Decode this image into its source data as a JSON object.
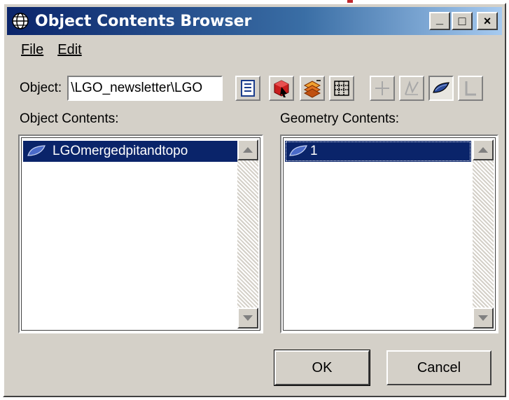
{
  "window": {
    "title": "Object Contents Browser",
    "title_icon": "globe-icon",
    "controls": {
      "minimize": "_",
      "maximize": "□",
      "close": "×"
    }
  },
  "menu": {
    "file": "File",
    "edit": "Edit"
  },
  "object": {
    "label": "Object:",
    "value": "\\LGO_newsletter\\LGO"
  },
  "toolbar": {
    "icons": [
      "properties-icon",
      "pick-object-icon",
      "explode-icon",
      "grid-icon",
      "point-icon",
      "polyline-icon",
      "surface-icon",
      "line-icon"
    ],
    "pressed": "surface-icon"
  },
  "object_contents": {
    "label": "Object Contents:",
    "items": [
      {
        "label": "LGOmergedpitandtopo",
        "icon": "surface-icon",
        "selected": true
      }
    ]
  },
  "geometry_contents": {
    "label": "Geometry Contents:",
    "items": [
      {
        "label": "1",
        "icon": "surface-icon",
        "selected": true
      }
    ]
  },
  "buttons": {
    "ok": "OK",
    "cancel": "Cancel"
  },
  "colors": {
    "title_start": "#0a246a",
    "selection": "#0a246a",
    "arrow": "#c0282d",
    "face": "#d4d0c8"
  }
}
